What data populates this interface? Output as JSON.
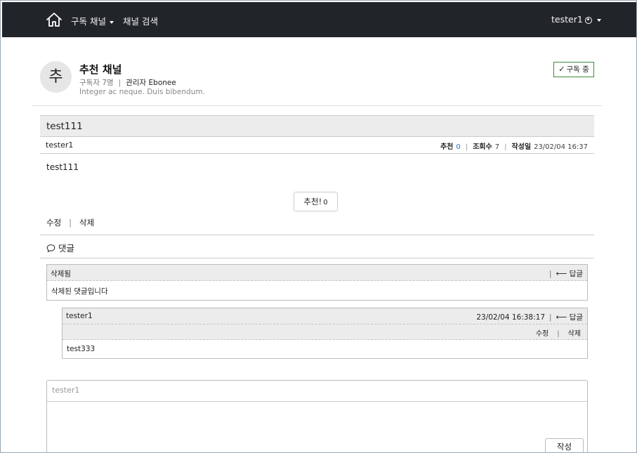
{
  "navbar": {
    "home_icon": "home-icon",
    "subscribed_channels": "구독 채널",
    "channel_search": "채널 검색",
    "username": "tester1"
  },
  "channel": {
    "avatar_letter": "추",
    "name": "추천 채널",
    "subscribers": "구독자 7명",
    "admin": "관리자 Ebonee",
    "description": "Integer ac neque. Duis bibendum.",
    "subscribe_button": "구독 중"
  },
  "post": {
    "title": "test111",
    "author": "tester1",
    "recommend_label": "추천",
    "recommend_count": "0",
    "views_label": "조회수",
    "views_count": "7",
    "date_label": "작성일",
    "date": "23/02/04 16:37",
    "body": "test111",
    "recommend_button": "추천!",
    "recommend_button_count": "0",
    "edit": "수정",
    "delete": "삭제"
  },
  "comments": {
    "header": "댓글",
    "items": [
      {
        "author": "삭제됨",
        "reply": "답글",
        "body": "삭제된 댓글입니다"
      },
      {
        "author": "tester1",
        "timestamp": "23/02/04 16:38:17",
        "reply": "답글",
        "edit": "수정",
        "delete": "삭제",
        "body": "test333"
      }
    ]
  },
  "comment_form": {
    "author": "tester1",
    "submit": "작성"
  }
}
